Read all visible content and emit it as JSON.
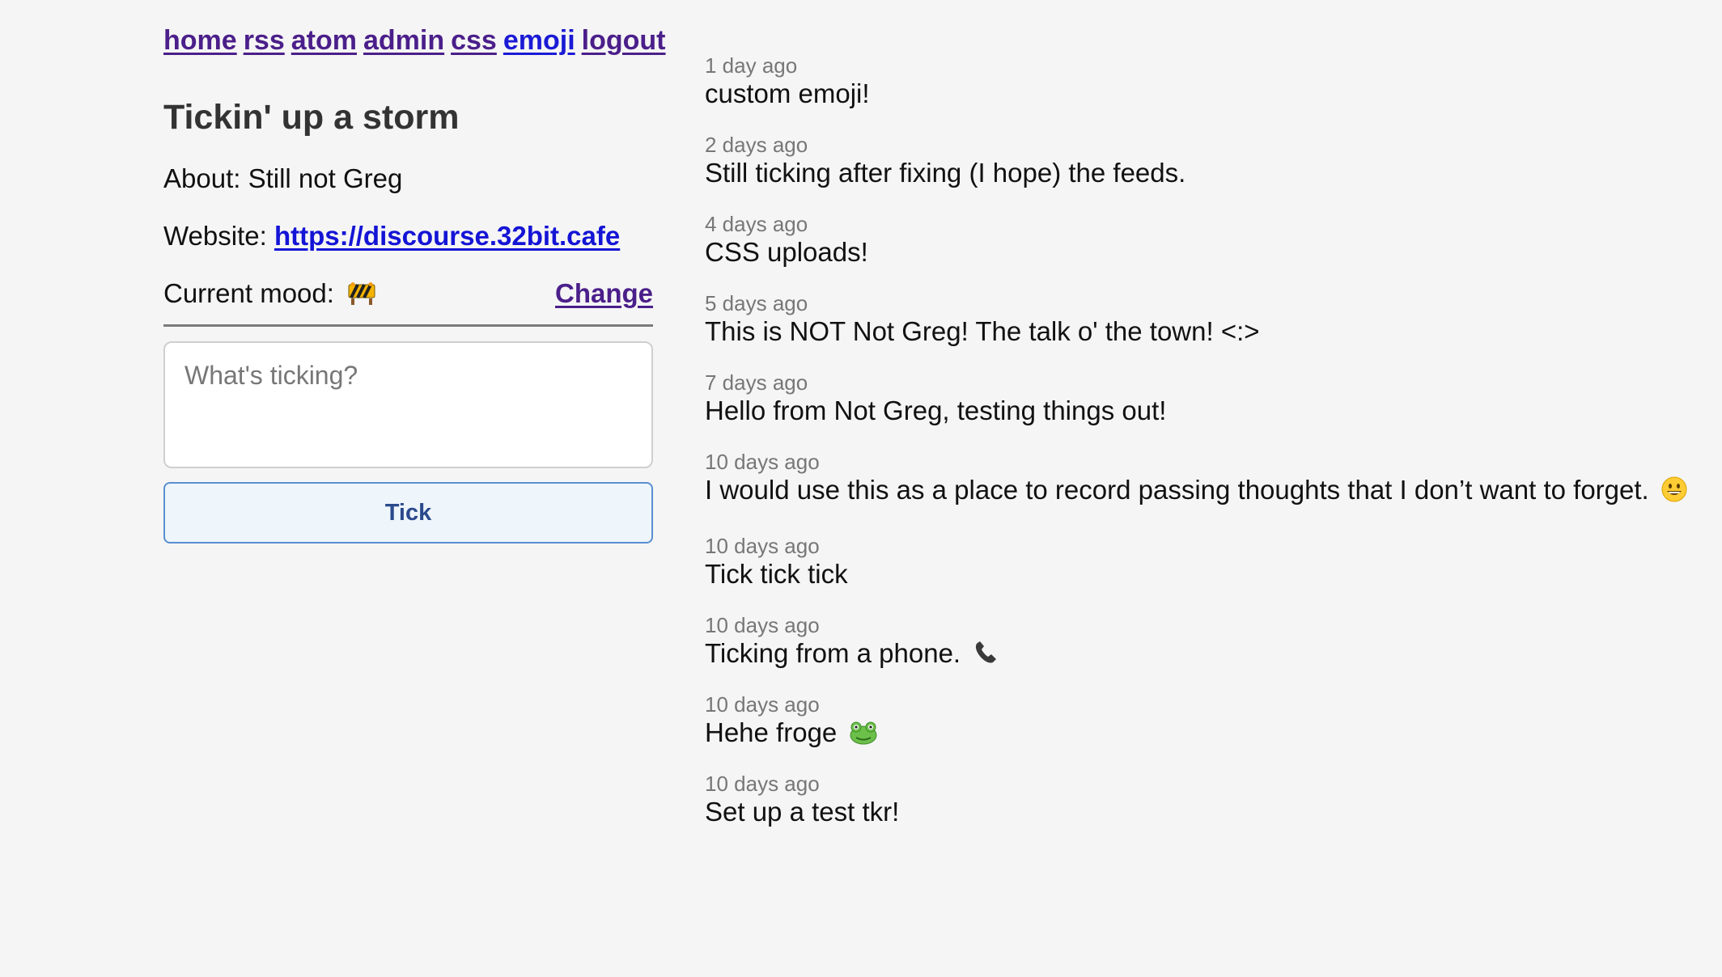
{
  "nav": {
    "items": [
      {
        "label": "home",
        "name": "nav-home"
      },
      {
        "label": "rss",
        "name": "nav-rss"
      },
      {
        "label": "atom",
        "name": "nav-atom"
      },
      {
        "label": "admin",
        "name": "nav-admin"
      },
      {
        "label": "css",
        "name": "nav-css"
      },
      {
        "label": "emoji",
        "name": "nav-emoji"
      },
      {
        "label": "logout",
        "name": "nav-logout"
      }
    ]
  },
  "profile": {
    "title": "Tickin' up a storm",
    "about": "About: Still not Greg",
    "website_label": "Website:",
    "website_url": "https://discourse.32bit.cafe",
    "mood_label": "Current mood:",
    "mood_icon": "construction-barrier-icon",
    "change_label": "Change"
  },
  "composer": {
    "placeholder": "What's ticking?",
    "value": "",
    "button_label": "Tick"
  },
  "feed": {
    "ticks": [
      {
        "time": "1 day ago",
        "text": "custom emoji!"
      },
      {
        "time": "2 days ago",
        "text": "Still ticking after fixing (I hope) the feeds."
      },
      {
        "time": "4 days ago",
        "text": "CSS uploads!"
      },
      {
        "time": "5 days ago",
        "text": "This is NOT Not Greg! The talk o' the town! <:>"
      },
      {
        "time": "7 days ago",
        "text": "Hello from Not Greg, testing things out!"
      },
      {
        "time": "10 days ago",
        "text": "I would use this as a place to record passing thoughts that I don’t want to forget.",
        "emoji": "grinning-face-icon"
      },
      {
        "time": "10 days ago",
        "text": "Tick tick tick"
      },
      {
        "time": "10 days ago",
        "text": "Ticking from a phone.",
        "emoji": "telephone-icon"
      },
      {
        "time": "10 days ago",
        "text": "Hehe froge",
        "emoji": "frog-icon"
      },
      {
        "time": "10 days ago",
        "text": "Set up a test tkr!"
      }
    ]
  },
  "colors": {
    "background": "#f5f5f5",
    "visited_link": "#4b1f8a",
    "link": "#1414d6",
    "button_border": "#5a8fd0",
    "button_bg": "#eef5fb"
  }
}
